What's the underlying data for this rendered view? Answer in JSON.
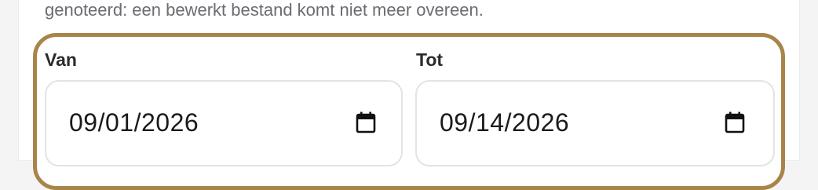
{
  "intro": {
    "text": "genoteerd: een bewerkt bestand komt niet meer overeen."
  },
  "range": {
    "from": {
      "label": "Van",
      "value": "09/01/2026",
      "icon": "calendar-icon"
    },
    "to": {
      "label": "Tot",
      "value": "09/14/2026",
      "icon": "calendar-icon"
    }
  },
  "colors": {
    "group_border": "#a9844a",
    "input_border": "#e3e3e6",
    "muted_text": "#6b6b72"
  }
}
